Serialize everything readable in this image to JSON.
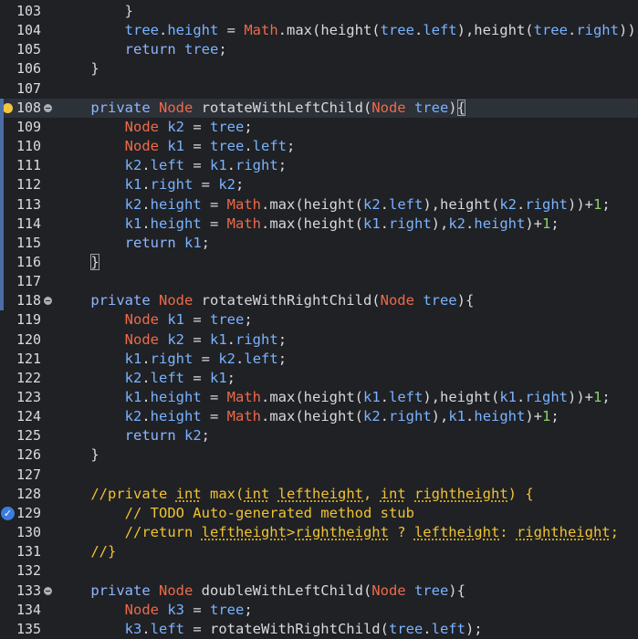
{
  "editor": {
    "lines": [
      {
        "n": "103",
        "tokens": [
          [
            "pl",
            "        }"
          ]
        ]
      },
      {
        "n": "104",
        "tokens": [
          [
            "pl",
            "        "
          ],
          [
            "fld",
            "tree"
          ],
          [
            "pl",
            "."
          ],
          [
            "fld",
            "height"
          ],
          [
            "pl",
            " = "
          ],
          [
            "cls",
            "Math"
          ],
          [
            "pl",
            ".max(height("
          ],
          [
            "fld",
            "tree"
          ],
          [
            "pl",
            "."
          ],
          [
            "fld",
            "left"
          ],
          [
            "pl",
            "),height("
          ],
          [
            "fld",
            "tree"
          ],
          [
            "pl",
            "."
          ],
          [
            "fld",
            "right"
          ],
          [
            "pl",
            "));"
          ]
        ]
      },
      {
        "n": "105",
        "tokens": [
          [
            "pl",
            "        "
          ],
          [
            "kw",
            "return"
          ],
          [
            "pl",
            " "
          ],
          [
            "fld",
            "tree"
          ],
          [
            "pl",
            ";"
          ]
        ]
      },
      {
        "n": "106",
        "tokens": [
          [
            "pl",
            "    }"
          ]
        ]
      },
      {
        "n": "107",
        "tokens": []
      },
      {
        "n": "108",
        "tokens": [
          [
            "pl",
            "    "
          ],
          [
            "kw",
            "private"
          ],
          [
            "pl",
            " "
          ],
          [
            "type",
            "Node"
          ],
          [
            "pl",
            " rotateWithLeftChild("
          ],
          [
            "type",
            "Node"
          ],
          [
            "pl",
            " "
          ],
          [
            "var",
            "tree"
          ],
          [
            "pl",
            ")"
          ],
          [
            "box",
            "{"
          ]
        ],
        "current": true,
        "bulb": true,
        "fold": true
      },
      {
        "n": "109",
        "tokens": [
          [
            "pl",
            "        "
          ],
          [
            "type",
            "Node"
          ],
          [
            "pl",
            " "
          ],
          [
            "var",
            "k2"
          ],
          [
            "pl",
            " = "
          ],
          [
            "var",
            "tree"
          ],
          [
            "pl",
            ";"
          ]
        ]
      },
      {
        "n": "110",
        "tokens": [
          [
            "pl",
            "        "
          ],
          [
            "type",
            "Node"
          ],
          [
            "pl",
            " "
          ],
          [
            "var",
            "k1"
          ],
          [
            "pl",
            " = "
          ],
          [
            "var",
            "tree"
          ],
          [
            "pl",
            "."
          ],
          [
            "fld",
            "left"
          ],
          [
            "pl",
            ";"
          ]
        ]
      },
      {
        "n": "111",
        "tokens": [
          [
            "pl",
            "        "
          ],
          [
            "var",
            "k2"
          ],
          [
            "pl",
            "."
          ],
          [
            "fld",
            "left"
          ],
          [
            "pl",
            " = "
          ],
          [
            "var",
            "k1"
          ],
          [
            "pl",
            "."
          ],
          [
            "fld",
            "right"
          ],
          [
            "pl",
            ";"
          ]
        ]
      },
      {
        "n": "112",
        "tokens": [
          [
            "pl",
            "        "
          ],
          [
            "var",
            "k1"
          ],
          [
            "pl",
            "."
          ],
          [
            "fld",
            "right"
          ],
          [
            "pl",
            " = "
          ],
          [
            "var",
            "k2"
          ],
          [
            "pl",
            ";"
          ]
        ]
      },
      {
        "n": "113",
        "tokens": [
          [
            "pl",
            "        "
          ],
          [
            "var",
            "k2"
          ],
          [
            "pl",
            "."
          ],
          [
            "fld",
            "height"
          ],
          [
            "pl",
            " = "
          ],
          [
            "cls",
            "Math"
          ],
          [
            "pl",
            ".max(height("
          ],
          [
            "var",
            "k2"
          ],
          [
            "pl",
            "."
          ],
          [
            "fld",
            "left"
          ],
          [
            "pl",
            "),height("
          ],
          [
            "var",
            "k2"
          ],
          [
            "pl",
            "."
          ],
          [
            "fld",
            "right"
          ],
          [
            "pl",
            "))+"
          ],
          [
            "num",
            "1"
          ],
          [
            "pl",
            ";"
          ]
        ]
      },
      {
        "n": "114",
        "tokens": [
          [
            "pl",
            "        "
          ],
          [
            "var",
            "k1"
          ],
          [
            "pl",
            "."
          ],
          [
            "fld",
            "height"
          ],
          [
            "pl",
            " = "
          ],
          [
            "cls",
            "Math"
          ],
          [
            "pl",
            ".max(height("
          ],
          [
            "var",
            "k1"
          ],
          [
            "pl",
            "."
          ],
          [
            "fld",
            "right"
          ],
          [
            "pl",
            "),"
          ],
          [
            "var",
            "k2"
          ],
          [
            "pl",
            "."
          ],
          [
            "fld",
            "height"
          ],
          [
            "pl",
            ")+"
          ],
          [
            "num",
            "1"
          ],
          [
            "pl",
            ";"
          ]
        ]
      },
      {
        "n": "115",
        "tokens": [
          [
            "pl",
            "        "
          ],
          [
            "kw",
            "return"
          ],
          [
            "pl",
            " "
          ],
          [
            "var",
            "k1"
          ],
          [
            "pl",
            ";"
          ]
        ]
      },
      {
        "n": "116",
        "tokens": [
          [
            "pl",
            "    "
          ],
          [
            "box",
            "}"
          ]
        ]
      },
      {
        "n": "117",
        "tokens": []
      },
      {
        "n": "118",
        "tokens": [
          [
            "pl",
            "    "
          ],
          [
            "kw",
            "private"
          ],
          [
            "pl",
            " "
          ],
          [
            "type",
            "Node"
          ],
          [
            "pl",
            " rotateWithRightChild("
          ],
          [
            "type",
            "Node"
          ],
          [
            "pl",
            " "
          ],
          [
            "var",
            "tree"
          ],
          [
            "pl",
            "){"
          ]
        ],
        "fold": true
      },
      {
        "n": "119",
        "tokens": [
          [
            "pl",
            "        "
          ],
          [
            "type",
            "Node"
          ],
          [
            "pl",
            " "
          ],
          [
            "var",
            "k1"
          ],
          [
            "pl",
            " = "
          ],
          [
            "var",
            "tree"
          ],
          [
            "pl",
            ";"
          ]
        ]
      },
      {
        "n": "120",
        "tokens": [
          [
            "pl",
            "        "
          ],
          [
            "type",
            "Node"
          ],
          [
            "pl",
            " "
          ],
          [
            "var",
            "k2"
          ],
          [
            "pl",
            " = "
          ],
          [
            "var",
            "k1"
          ],
          [
            "pl",
            "."
          ],
          [
            "fld",
            "right"
          ],
          [
            "pl",
            ";"
          ]
        ]
      },
      {
        "n": "121",
        "tokens": [
          [
            "pl",
            "        "
          ],
          [
            "var",
            "k1"
          ],
          [
            "pl",
            "."
          ],
          [
            "fld",
            "right"
          ],
          [
            "pl",
            " = "
          ],
          [
            "var",
            "k2"
          ],
          [
            "pl",
            "."
          ],
          [
            "fld",
            "left"
          ],
          [
            "pl",
            ";"
          ]
        ]
      },
      {
        "n": "122",
        "tokens": [
          [
            "pl",
            "        "
          ],
          [
            "var",
            "k2"
          ],
          [
            "pl",
            "."
          ],
          [
            "fld",
            "left"
          ],
          [
            "pl",
            " = "
          ],
          [
            "var",
            "k1"
          ],
          [
            "pl",
            ";"
          ]
        ]
      },
      {
        "n": "123",
        "tokens": [
          [
            "pl",
            "        "
          ],
          [
            "var",
            "k1"
          ],
          [
            "pl",
            "."
          ],
          [
            "fld",
            "height"
          ],
          [
            "pl",
            " = "
          ],
          [
            "cls",
            "Math"
          ],
          [
            "pl",
            ".max(height("
          ],
          [
            "var",
            "k1"
          ],
          [
            "pl",
            "."
          ],
          [
            "fld",
            "left"
          ],
          [
            "pl",
            "),height("
          ],
          [
            "var",
            "k1"
          ],
          [
            "pl",
            "."
          ],
          [
            "fld",
            "right"
          ],
          [
            "pl",
            "))+"
          ],
          [
            "num",
            "1"
          ],
          [
            "pl",
            ";"
          ]
        ]
      },
      {
        "n": "124",
        "tokens": [
          [
            "pl",
            "        "
          ],
          [
            "var",
            "k2"
          ],
          [
            "pl",
            "."
          ],
          [
            "fld",
            "height"
          ],
          [
            "pl",
            " = "
          ],
          [
            "cls",
            "Math"
          ],
          [
            "pl",
            ".max(height("
          ],
          [
            "var",
            "k2"
          ],
          [
            "pl",
            "."
          ],
          [
            "fld",
            "right"
          ],
          [
            "pl",
            "),"
          ],
          [
            "var",
            "k1"
          ],
          [
            "pl",
            "."
          ],
          [
            "fld",
            "height"
          ],
          [
            "pl",
            ")+"
          ],
          [
            "num",
            "1"
          ],
          [
            "pl",
            ";"
          ]
        ]
      },
      {
        "n": "125",
        "tokens": [
          [
            "pl",
            "        "
          ],
          [
            "kw",
            "return"
          ],
          [
            "pl",
            " "
          ],
          [
            "var",
            "k2"
          ],
          [
            "pl",
            ";"
          ]
        ]
      },
      {
        "n": "126",
        "tokens": [
          [
            "pl",
            "    }"
          ]
        ]
      },
      {
        "n": "127",
        "tokens": []
      },
      {
        "n": "128",
        "tokens": [
          [
            "cm",
            "    //private "
          ],
          [
            "cmsq",
            "int"
          ],
          [
            "cm",
            " max("
          ],
          [
            "cmsq",
            "int"
          ],
          [
            "cm",
            " "
          ],
          [
            "cmsq",
            "leftheight"
          ],
          [
            "cm",
            ", "
          ],
          [
            "cmsq",
            "int"
          ],
          [
            "cm",
            " "
          ],
          [
            "cmsq",
            "rightheight"
          ],
          [
            "cm",
            ") {"
          ]
        ]
      },
      {
        "n": "129",
        "tokens": [
          [
            "cm",
            "        // TODO Auto-generated method stub"
          ]
        ],
        "check": true
      },
      {
        "n": "130",
        "tokens": [
          [
            "cm",
            "        //return "
          ],
          [
            "cmsq",
            "leftheight"
          ],
          [
            "cm",
            ">"
          ],
          [
            "cmsq",
            "rightheight"
          ],
          [
            "cm",
            " ? "
          ],
          [
            "cmsq",
            "leftheight"
          ],
          [
            "cm",
            ": "
          ],
          [
            "cmsq",
            "rightheight"
          ],
          [
            "cm",
            ";"
          ]
        ]
      },
      {
        "n": "131",
        "tokens": [
          [
            "cm",
            "    //}"
          ]
        ]
      },
      {
        "n": "132",
        "tokens": []
      },
      {
        "n": "133",
        "tokens": [
          [
            "pl",
            "    "
          ],
          [
            "kw",
            "private"
          ],
          [
            "pl",
            " "
          ],
          [
            "type",
            "Node"
          ],
          [
            "pl",
            " doubleWithLeftChild("
          ],
          [
            "type",
            "Node"
          ],
          [
            "pl",
            " "
          ],
          [
            "var",
            "tree"
          ],
          [
            "pl",
            "){"
          ]
        ],
        "fold": true
      },
      {
        "n": "134",
        "tokens": [
          [
            "pl",
            "        "
          ],
          [
            "type",
            "Node"
          ],
          [
            "pl",
            " "
          ],
          [
            "var",
            "k3"
          ],
          [
            "pl",
            " = "
          ],
          [
            "var",
            "tree"
          ],
          [
            "pl",
            ";"
          ]
        ]
      },
      {
        "n": "135",
        "tokens": [
          [
            "pl",
            "        "
          ],
          [
            "var",
            "k3"
          ],
          [
            "pl",
            "."
          ],
          [
            "fld",
            "left"
          ],
          [
            "pl",
            " = rotateWithRightChild("
          ],
          [
            "var",
            "tree"
          ],
          [
            "pl",
            "."
          ],
          [
            "fld",
            "left"
          ],
          [
            "pl",
            ");"
          ]
        ]
      }
    ],
    "colors": {
      "background": "#1f2125",
      "keyword": "#8fb6ff",
      "type": "#ee6a4a",
      "variable": "#7ab3ff",
      "number": "#8bd26a",
      "comment": "#f1c232"
    },
    "icons": {
      "bulb": "lightbulb-icon",
      "check": "bookmark-check-icon",
      "fold": "fold-collapse-icon"
    }
  }
}
